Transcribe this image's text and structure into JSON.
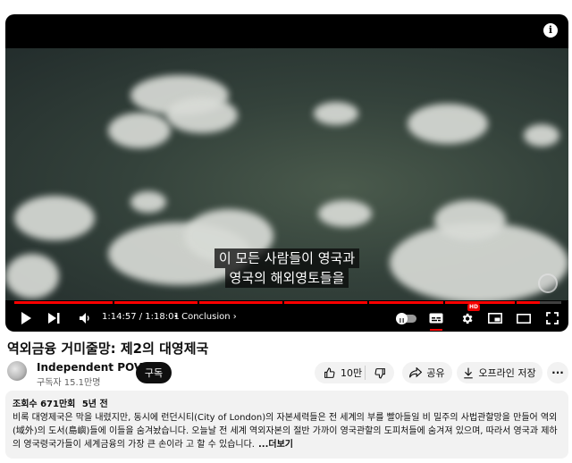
{
  "player": {
    "info_icon": "info-icon",
    "subtitle_line1": "이 모든 사람들이 영국과",
    "subtitle_line2": "영국의 해외영토들을",
    "current_time": "1:14:57",
    "duration": "1:18:01",
    "time_text": "1:14:57 / 1:18:01",
    "chapter_bullet": "•",
    "chapter_label": "Conclusion",
    "progress_fraction": 0.9605,
    "hd_badge": "HD",
    "accent_color": "#ff0000"
  },
  "video": {
    "title": "역외금융 거미줄망: 제2의 대영제국"
  },
  "channel": {
    "name": "Independent POV",
    "subscribers": "구독자 15.1만명",
    "subscribe_label": "구독"
  },
  "actions": {
    "like_count": "10만",
    "share_label": "공유",
    "offline_label": "오프라인 저장",
    "more_label": "···"
  },
  "description": {
    "views": "조회수 671만회",
    "age": "5년 전",
    "text": "비록 대영제국은 막을 내렸지만, 동시에 런던시티(City of London)의 자본세력들은 전 세계의 부를 빨아들일 비 밀주의 사법관할망을 만들어 역외(域外)의 도서(島嶼)들에 이들을 숨겨놨습니다. 오늘날 전 세계 역외자본의 절반 가까이 영국관할의 도피처들에 숨겨져 있으며, 따라서 영국과 제하의 영국령국가들이 세계금융의 가장 큰 손이라 고 할 수 있습니다.",
    "more_label": "...더보기"
  }
}
